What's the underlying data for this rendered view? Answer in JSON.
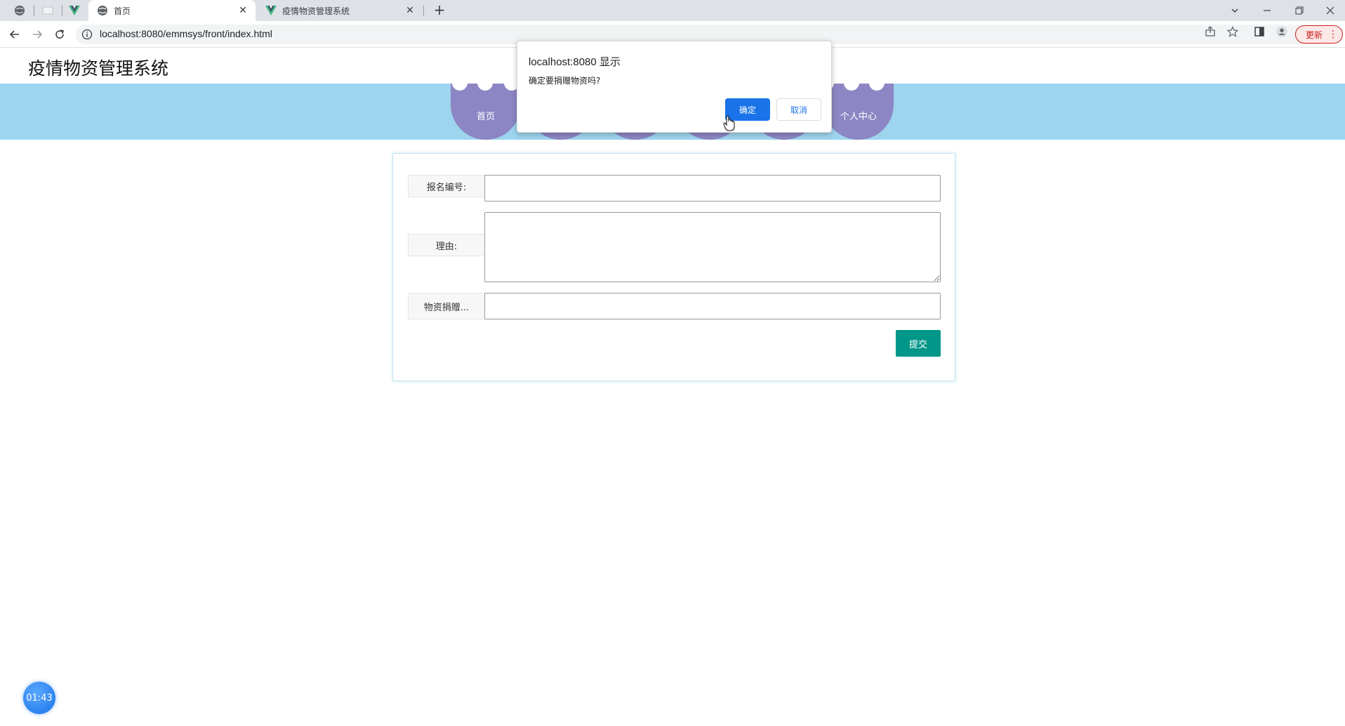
{
  "browser": {
    "tabs": [
      {
        "title": "首页",
        "active": true
      },
      {
        "title": "疫情物资管理系统",
        "active": false
      }
    ],
    "address": "localhost:8080/emmsys/front/index.html",
    "update_label": "更新"
  },
  "site": {
    "title": "疫情物资管理系统",
    "nav": [
      {
        "label": "首页"
      },
      {
        "label": ""
      },
      {
        "label": ""
      },
      {
        "label": ""
      },
      {
        "label": ""
      },
      {
        "label": "个人中心"
      }
    ]
  },
  "form": {
    "fields": [
      {
        "label": "报名编号:",
        "value": ""
      },
      {
        "label": "理由:",
        "value": ""
      },
      {
        "label": "物资捐赠...",
        "value": ""
      }
    ],
    "submit_label": "提交"
  },
  "dialog": {
    "title": "localhost:8080 显示",
    "message": "确定要捐赠物资吗?",
    "ok_label": "确定",
    "cancel_label": "取消"
  },
  "timer": {
    "text": "01:43"
  },
  "colors": {
    "nav_band": "#9dd4ee",
    "nav_item": "#8d86c4",
    "submit": "#009688",
    "dialog_ok": "#1a73e8"
  }
}
